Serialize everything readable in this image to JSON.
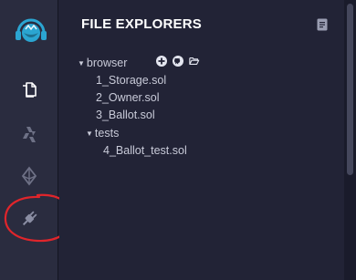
{
  "explorer": {
    "title": "FILE EXPLORERS"
  },
  "tree": {
    "root": {
      "label": "browser",
      "expanded": true
    },
    "files": [
      {
        "label": "1_Storage.sol"
      },
      {
        "label": "2_Owner.sol"
      },
      {
        "label": "3_Ballot.sol"
      }
    ],
    "subfolder": {
      "label": "tests",
      "expanded": true
    },
    "subfiles": [
      {
        "label": "4_Ballot_test.sol"
      }
    ]
  },
  "icons": {
    "logo": "remix-logo-icon",
    "file-explorer": "files-icon",
    "compiler": "solidity-compiler-icon",
    "deploy": "ethereum-icon",
    "plugin-manager": "plug-icon",
    "add-file": "plus-circle-icon",
    "github": "github-icon",
    "open-folder": "folder-open-icon",
    "doc": "document-icon"
  },
  "colors": {
    "background": "#222336",
    "icon_panel": "#2a2c3f",
    "accent": "#2ba5d1",
    "annotation": "#e0252b"
  }
}
